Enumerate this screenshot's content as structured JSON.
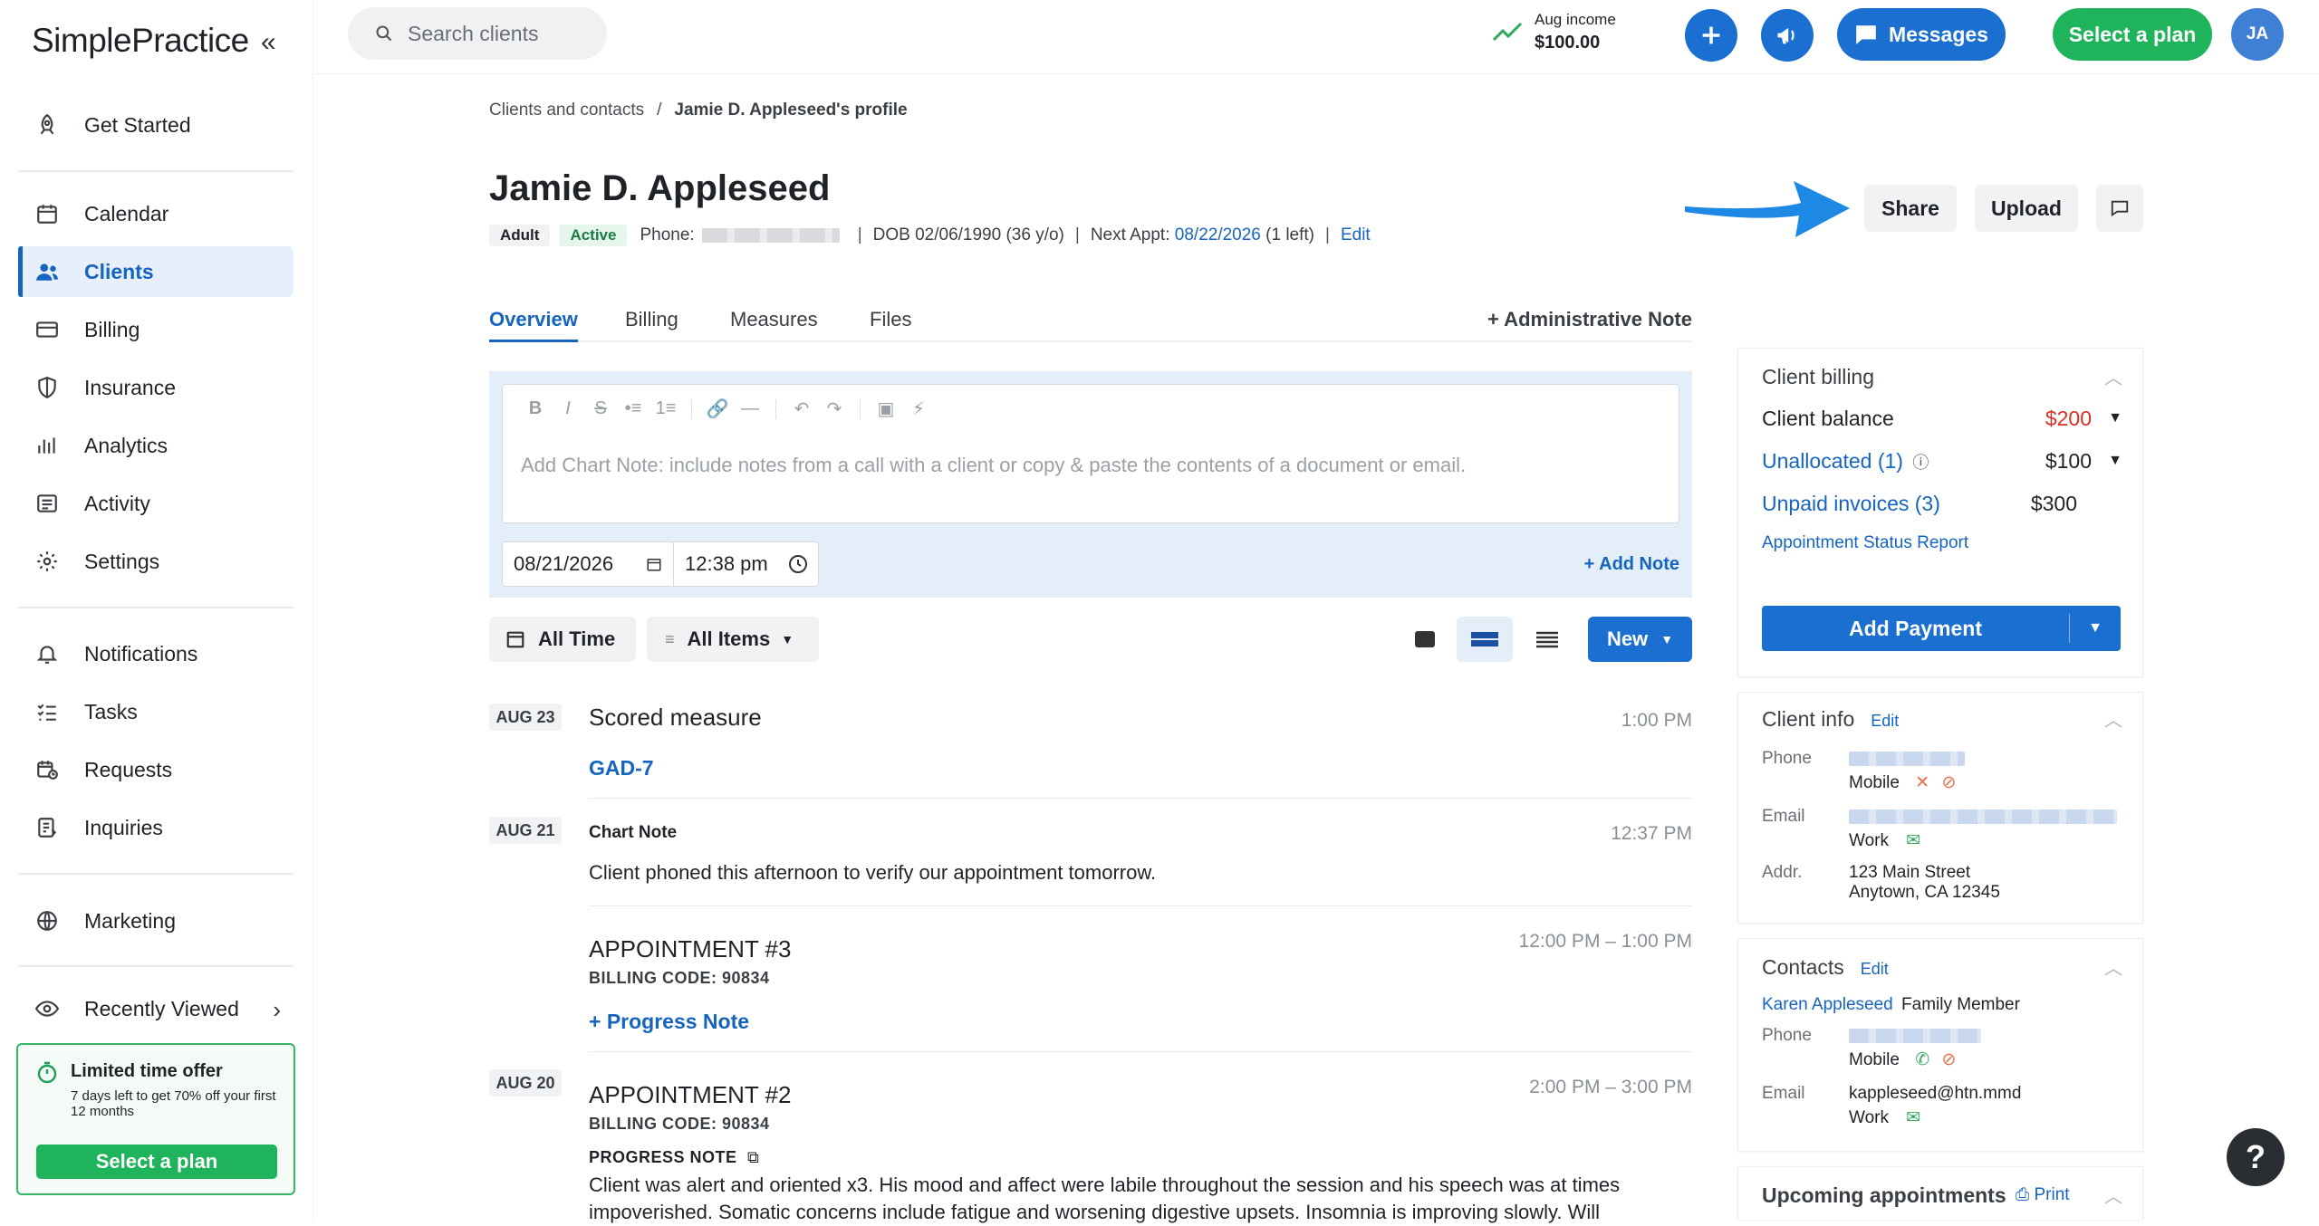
{
  "sidebar": {
    "logo": "SimplePractice",
    "collapse_icon": "«",
    "items": [
      {
        "label": "Get Started",
        "icon": "rocket-icon"
      },
      {
        "label": "Calendar",
        "icon": "calendar-icon"
      },
      {
        "label": "Clients",
        "icon": "users-icon",
        "active": true
      },
      {
        "label": "Billing",
        "icon": "credit-card-icon"
      },
      {
        "label": "Insurance",
        "icon": "shield-icon"
      },
      {
        "label": "Analytics",
        "icon": "bar-chart-icon"
      },
      {
        "label": "Activity",
        "icon": "list-icon"
      },
      {
        "label": "Settings",
        "icon": "gear-icon"
      },
      {
        "label": "Notifications",
        "icon": "bell-icon"
      },
      {
        "label": "Tasks",
        "icon": "checklist-icon"
      },
      {
        "label": "Requests",
        "icon": "calendar-clock-icon"
      },
      {
        "label": "Inquiries",
        "icon": "form-icon"
      },
      {
        "label": "Marketing",
        "icon": "globe-icon"
      },
      {
        "label": "Recently Viewed",
        "icon": "eye-icon"
      }
    ],
    "offer": {
      "title": "Limited time offer",
      "description": "7 days left to get 70% off your first 12 months",
      "button": "Select a plan"
    }
  },
  "topbar": {
    "search_placeholder": "Search clients",
    "income_label": "Aug income",
    "income_value": "$100.00",
    "messages_label": "Messages",
    "plan_label": "Select a plan",
    "avatar_initials": "JA"
  },
  "profile": {
    "breadcrumb_root": "Clients and contacts",
    "breadcrumb_sep": "/",
    "breadcrumb_current": "Jamie D. Appleseed's profile",
    "name": "Jamie D. Appleseed",
    "tag_adult": "Adult",
    "tag_active": "Active",
    "phone_label": "Phone:",
    "separator": "|",
    "dob": "DOB 02/06/1990 (36 y/o)",
    "next_appt_label": "Next Appt:",
    "next_appt_date": "08/22/2026",
    "next_appt_left": "(1 left)",
    "edit_label": "Edit",
    "share_label": "Share",
    "upload_label": "Upload"
  },
  "tabs": [
    {
      "label": "Overview",
      "active": true
    },
    {
      "label": "Billing"
    },
    {
      "label": "Measures"
    },
    {
      "label": "Files"
    }
  ],
  "admin_note_label": "+ Administrative Note",
  "editor": {
    "placeholder": "Add Chart Note: include notes from a call with a client or copy & paste the contents of a document or email.",
    "date": "08/21/2026",
    "time": "12:38 pm",
    "add_note_label": "+ Add Note",
    "toolbar": [
      "B",
      "I",
      "S",
      "•≡",
      "1≡",
      "🔗",
      "—",
      "↶",
      "↷",
      "▣",
      "⚡"
    ]
  },
  "filters": {
    "all_time": "All Time",
    "all_items": "All Items",
    "new_label": "New"
  },
  "timeline": {
    "d1": "AUG 23",
    "e1_title": "Scored measure",
    "e1_time": "1:00 PM",
    "e1_link": "GAD-7",
    "d2": "AUG 21",
    "e2_title": "Chart Note",
    "e2_time": "12:37 PM",
    "e2_text": "Client phoned this afternoon to verify our appointment tomorrow.",
    "e3_title": "APPOINTMENT #3",
    "e3_time": "12:00 PM – 1:00 PM",
    "e3_code": "BILLING CODE: 90834",
    "e3_link": "+ Progress Note",
    "d3": "AUG 20",
    "e4_title": "APPOINTMENT #2",
    "e4_time": "2:00 PM – 3:00 PM",
    "e4_code": "BILLING CODE: 90834",
    "e4_sub": "PROGRESS NOTE",
    "e4_text": "Client was alert and oriented x3. His mood and affect were labile throughout the session and his speech was at times impoverished. Somatic concerns include fatigue and worsening digestive upsets. Insomnia is improving slowly. Will"
  },
  "billing_card": {
    "title": "Client billing",
    "balance_label": "Client balance",
    "balance_value": "$200",
    "balance_color": "#d93025",
    "unallocated_label": "Unallocated (1)",
    "unallocated_value": "$100",
    "unpaid_label": "Unpaid invoices (3)",
    "unpaid_value": "$300",
    "report_label": "Appointment Status Report",
    "add_payment_label": "Add Payment"
  },
  "info_card": {
    "title": "Client info",
    "edit": "Edit",
    "phone_label": "Phone",
    "phone_type": "Mobile",
    "email_label": "Email",
    "email_type": "Work",
    "addr_label": "Addr.",
    "addr_line1": "123 Main Street",
    "addr_line2": "Anytown, CA 12345"
  },
  "contacts_card": {
    "title": "Contacts",
    "edit": "Edit",
    "contact_name": "Karen Appleseed",
    "contact_relation": "Family Member",
    "phone_label": "Phone",
    "phone_type": "Mobile",
    "email_label": "Email",
    "email_value": "kappleseed@htn.mmd",
    "email_type": "Work"
  },
  "appointments_card": {
    "title": "Upcoming appointments",
    "print_label": "Print"
  },
  "help_label": "?"
}
